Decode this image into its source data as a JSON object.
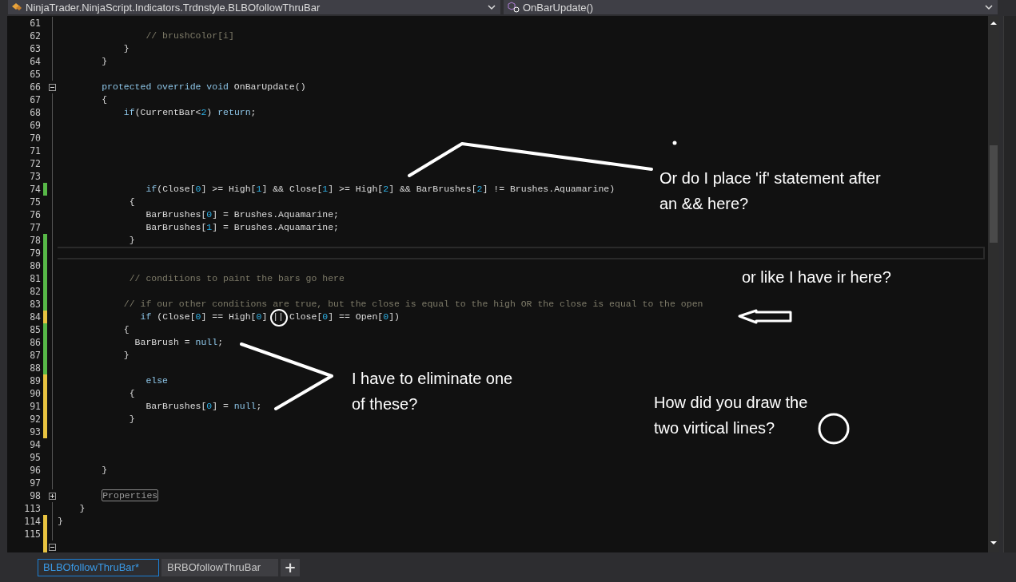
{
  "navigation": {
    "type_dropdown": "NinjaTrader.NinjaScript.Indicators.Trdnstyle.BLBOfollowThruBar",
    "member_dropdown": "OnBarUpdate()"
  },
  "lines": [
    {
      "number": "61"
    },
    {
      "number": "62",
      "tokens": [
        {
          "kind": "comment",
          "text": "                // brushColor[i]"
        }
      ]
    },
    {
      "number": "63",
      "tokens": [
        {
          "kind": "plain",
          "text": "            }"
        }
      ]
    },
    {
      "number": "64",
      "tokens": [
        {
          "kind": "plain",
          "text": "        }"
        }
      ]
    },
    {
      "number": "65"
    },
    {
      "number": "66",
      "collapsed": false,
      "tokens": [
        {
          "kind": "kw",
          "text": "        protected override void"
        },
        {
          "kind": "plain",
          "text": " OnBarUpdate()"
        }
      ]
    },
    {
      "number": "67",
      "tokens": [
        {
          "kind": "plain",
          "text": "        {"
        }
      ]
    },
    {
      "number": "68",
      "tokens": [
        {
          "kind": "kw",
          "text": "            if"
        },
        {
          "kind": "plain",
          "text": "(CurrentBar<"
        },
        {
          "kind": "num",
          "text": "2"
        },
        {
          "kind": "plain",
          "text": ") "
        },
        {
          "kind": "kw",
          "text": "return"
        },
        {
          "kind": "plain",
          "text": ";"
        }
      ]
    },
    {
      "number": "69"
    },
    {
      "number": "70"
    },
    {
      "number": "71"
    },
    {
      "number": "72"
    },
    {
      "number": "73"
    },
    {
      "number": "74",
      "color": "#57b847",
      "tokens": [
        {
          "kind": "kw",
          "text": "                if"
        },
        {
          "kind": "plain",
          "text": "(Close["
        },
        {
          "kind": "num",
          "text": "0"
        },
        {
          "kind": "plain",
          "text": "] >= High["
        },
        {
          "kind": "num",
          "text": "1"
        },
        {
          "kind": "plain",
          "text": "] && Close["
        },
        {
          "kind": "num",
          "text": "1"
        },
        {
          "kind": "plain",
          "text": "] >= High["
        },
        {
          "kind": "num",
          "text": "2"
        },
        {
          "kind": "plain",
          "text": "] && BarBrushes["
        },
        {
          "kind": "num",
          "text": "2"
        },
        {
          "kind": "plain",
          "text": "] != Brushes.Aquamarine)"
        }
      ]
    },
    {
      "number": "75",
      "tokens": [
        {
          "kind": "plain",
          "text": "             {"
        }
      ]
    },
    {
      "number": "76",
      "tokens": [
        {
          "kind": "plain",
          "text": "                BarBrushes["
        },
        {
          "kind": "num",
          "text": "0"
        },
        {
          "kind": "plain",
          "text": "] = Brushes.Aquamarine;"
        }
      ]
    },
    {
      "number": "77",
      "tokens": [
        {
          "kind": "plain",
          "text": "                BarBrushes["
        },
        {
          "kind": "num",
          "text": "1"
        },
        {
          "kind": "plain",
          "text": "] = Brushes.Aquamarine;"
        }
      ]
    },
    {
      "number": "78",
      "color": "#57b847",
      "tokens": [
        {
          "kind": "plain",
          "text": "             }"
        }
      ]
    },
    {
      "number": "79",
      "color": "#57b847",
      "current": true
    },
    {
      "number": "80",
      "color": "#57b847"
    },
    {
      "number": "81",
      "color": "#57b847",
      "tokens": [
        {
          "kind": "comment",
          "text": "             // conditions to paint the bars go here"
        }
      ]
    },
    {
      "number": "82",
      "color": "#57b847"
    },
    {
      "number": "83",
      "color": "#57b847",
      "tokens": [
        {
          "kind": "comment",
          "text": "            // if our other conditions are true, but the close is equal to the high OR the close is equal to the open"
        }
      ]
    },
    {
      "number": "84",
      "color": "#e8c340",
      "tokens": [
        {
          "kind": "kw",
          "text": "               if"
        },
        {
          "kind": "plain",
          "text": " (Close["
        },
        {
          "kind": "num",
          "text": "0"
        },
        {
          "kind": "plain",
          "text": "] == High["
        },
        {
          "kind": "num",
          "text": "0"
        },
        {
          "kind": "plain",
          "text": "] "
        },
        {
          "kind": "circled",
          "text": "||"
        },
        {
          "kind": "plain",
          "text": " Close["
        },
        {
          "kind": "num",
          "text": "0"
        },
        {
          "kind": "plain",
          "text": "] == Open["
        },
        {
          "kind": "num",
          "text": "0"
        },
        {
          "kind": "plain",
          "text": "])"
        }
      ]
    },
    {
      "number": "85",
      "color": "#57b847",
      "tokens": [
        {
          "kind": "plain",
          "text": "            {"
        }
      ]
    },
    {
      "number": "86",
      "color": "#57b847",
      "tokens": [
        {
          "kind": "plain",
          "text": "              BarBrush = "
        },
        {
          "kind": "kw",
          "text": "null"
        },
        {
          "kind": "plain",
          "text": ";"
        }
      ]
    },
    {
      "number": "87",
      "color": "#57b847",
      "tokens": [
        {
          "kind": "plain",
          "text": "            }"
        }
      ]
    },
    {
      "number": "88",
      "color": "#57b847"
    },
    {
      "number": "89",
      "color": "#e8c340",
      "tokens": [
        {
          "kind": "kw",
          "text": "                else"
        }
      ]
    },
    {
      "number": "90",
      "color": "#e8c340",
      "tokens": [
        {
          "kind": "plain",
          "text": "             {"
        }
      ]
    },
    {
      "number": "91",
      "color": "#e8c340",
      "tokens": [
        {
          "kind": "plain",
          "text": "                BarBrushes["
        },
        {
          "kind": "num",
          "text": "0"
        },
        {
          "kind": "plain",
          "text": "] = "
        },
        {
          "kind": "kw",
          "text": "null"
        },
        {
          "kind": "plain",
          "text": ";"
        }
      ]
    },
    {
      "number": "92",
      "color": "#e8c340",
      "tokens": [
        {
          "kind": "plain",
          "text": "             }"
        }
      ]
    },
    {
      "number": "93",
      "color": "#e8c340"
    },
    {
      "number": "94"
    },
    {
      "number": "95"
    },
    {
      "number": "96",
      "tokens": [
        {
          "kind": "plain",
          "text": "        }"
        }
      ]
    },
    {
      "number": "97"
    },
    {
      "number": "98",
      "collapsed": true,
      "tokens": [
        {
          "kind": "collapsed",
          "text": "Properties"
        }
      ]
    },
    {
      "number": "113",
      "tokens": [
        {
          "kind": "plain",
          "text": "    }"
        }
      ]
    },
    {
      "number": "114",
      "color": "#e8c340",
      "tokens": [
        {
          "kind": "plain",
          "text": "}"
        }
      ]
    },
    {
      "number": "115",
      "color": "#e8c340"
    },
    {
      "color": "#e8c340",
      "collapsed": false
    }
  ],
  "annotations": [
    {
      "lines": [
        "Or do I place 'if' statement after",
        "an && here?"
      ]
    },
    {
      "lines": [
        "or like I have ir here?"
      ]
    },
    {
      "lines": [
        "I have to eliminate one",
        "of these?"
      ]
    },
    {
      "lines": [
        "How did you draw the",
        "two virtical lines?"
      ]
    }
  ],
  "tabs": [
    {
      "label": "BLBOfollowThruBar*",
      "selected": true
    },
    {
      "label": "BRBOfollowThruBar",
      "selected": false
    }
  ],
  "new_tab_button": "+"
}
